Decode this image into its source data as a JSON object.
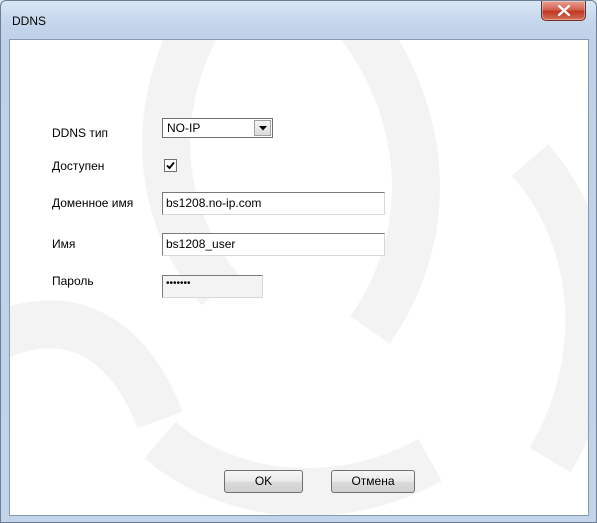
{
  "window": {
    "title": "DDNS"
  },
  "form": {
    "ddns_type": {
      "label": "DDNS тип",
      "value": "NO-IP"
    },
    "enabled": {
      "label": "Доступен",
      "checked": true
    },
    "domain": {
      "label": "Доменное имя",
      "value": "bs1208.no-ip.com"
    },
    "username": {
      "label": "Имя",
      "value": "bs1208_user"
    },
    "password": {
      "label": "Пароль",
      "value": "•••••••"
    }
  },
  "buttons": {
    "ok_label": "OK",
    "cancel_label": "Отмена"
  },
  "icons": {
    "close": "close-icon",
    "dropdown": "chevron-down-icon",
    "check": "checkmark-icon"
  },
  "colors": {
    "close_button": "#c8442d",
    "window_frame": "#c2d4ea"
  }
}
